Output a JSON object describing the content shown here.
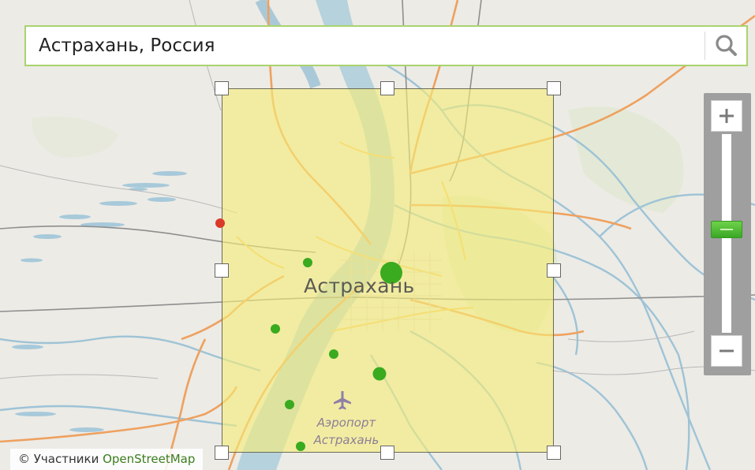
{
  "search": {
    "value": "Астрахань, Россия",
    "accent_color": "#a9d36f"
  },
  "search_button": {
    "icon": "magnifier-icon"
  },
  "zoom": {
    "zoom_in_icon": "plus-icon",
    "zoom_out_icon": "minus-icon",
    "level": 0.6
  },
  "map": {
    "city_label": "Астрахань",
    "airport_label_line1": "Аэропорт",
    "airport_label_line2": "Астрахань",
    "airport_icon": "airplane-icon"
  },
  "selection": {
    "fill_color": "#f6ee78"
  },
  "markers": {
    "green_color": "#3aaa1f",
    "red_color": "#d93a2a"
  },
  "attribution": {
    "prefix": "© Участники ",
    "link": "OpenStreetMap"
  }
}
